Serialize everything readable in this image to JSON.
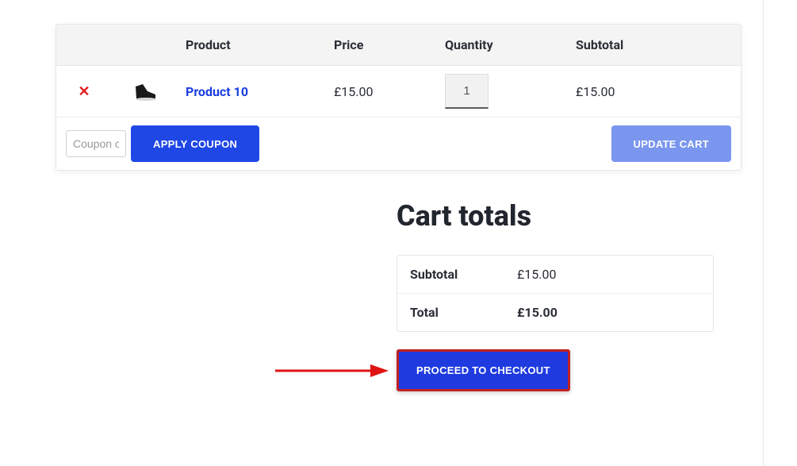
{
  "headers": {
    "product": "Product",
    "price": "Price",
    "quantity": "Quantity",
    "subtotal": "Subtotal"
  },
  "cart": {
    "items": [
      {
        "remove_icon": "✕",
        "name": "Product 10",
        "price": "£15.00",
        "quantity": "1",
        "subtotal": "£15.00"
      }
    ]
  },
  "coupon": {
    "placeholder": "Coupon code",
    "apply_label": "APPLY COUPON"
  },
  "update_cart_label": "UPDATE CART",
  "cart_totals": {
    "title": "Cart totals",
    "subtotal_label": "Subtotal",
    "subtotal_value": "£15.00",
    "total_label": "Total",
    "total_value": "£15.00"
  },
  "checkout_label": "PROCEED TO CHECKOUT"
}
